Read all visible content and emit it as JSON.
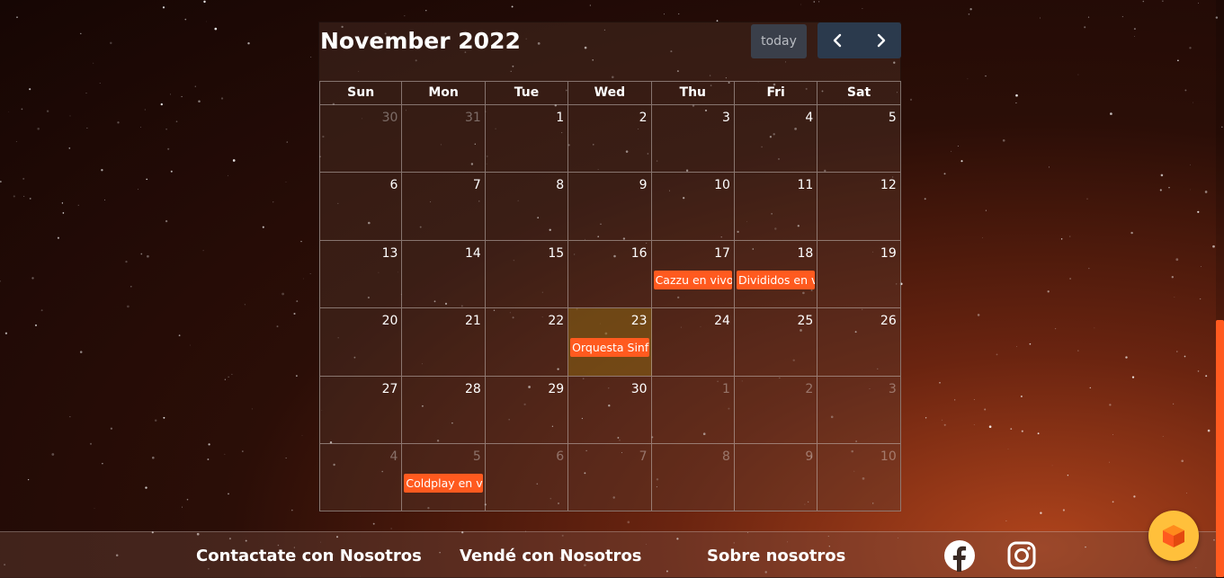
{
  "calendar": {
    "title": "November 2022",
    "today_label": "today",
    "weekdays": [
      "Sun",
      "Mon",
      "Tue",
      "Wed",
      "Thu",
      "Fri",
      "Sat"
    ],
    "weeks": [
      [
        {
          "day": "30",
          "other": true
        },
        {
          "day": "31",
          "other": true
        },
        {
          "day": "1"
        },
        {
          "day": "2"
        },
        {
          "day": "3"
        },
        {
          "day": "4"
        },
        {
          "day": "5"
        }
      ],
      [
        {
          "day": "6"
        },
        {
          "day": "7"
        },
        {
          "day": "8"
        },
        {
          "day": "9"
        },
        {
          "day": "10"
        },
        {
          "day": "11"
        },
        {
          "day": "12"
        }
      ],
      [
        {
          "day": "13"
        },
        {
          "day": "14"
        },
        {
          "day": "15"
        },
        {
          "day": "16"
        },
        {
          "day": "17",
          "event": "Cazzu en vivo"
        },
        {
          "day": "18",
          "event": "Divididos en v"
        },
        {
          "day": "19"
        }
      ],
      [
        {
          "day": "20"
        },
        {
          "day": "21"
        },
        {
          "day": "22"
        },
        {
          "day": "23",
          "today": true,
          "event": "Orquesta Sinfo"
        },
        {
          "day": "24"
        },
        {
          "day": "25"
        },
        {
          "day": "26"
        }
      ],
      [
        {
          "day": "27"
        },
        {
          "day": "28"
        },
        {
          "day": "29"
        },
        {
          "day": "30"
        },
        {
          "day": "1",
          "other": true
        },
        {
          "day": "2",
          "other": true
        },
        {
          "day": "3",
          "other": true
        }
      ],
      [
        {
          "day": "4",
          "other": true
        },
        {
          "day": "5",
          "other": true,
          "event": "Coldplay en vi"
        },
        {
          "day": "6",
          "other": true
        },
        {
          "day": "7",
          "other": true
        },
        {
          "day": "8",
          "other": true
        },
        {
          "day": "9",
          "other": true
        },
        {
          "day": "10",
          "other": true
        }
      ]
    ]
  },
  "footer": {
    "contact": "Contactate con Nosotros",
    "sell": "Vendé con Nosotros",
    "about": "Sobre nosotros",
    "social": [
      "facebook-icon",
      "instagram-icon"
    ]
  },
  "colors": {
    "event": "#ff5a1f",
    "today_bg": "#8c6414",
    "nav_bg": "#2b3a4d",
    "fab": "#ffc03b"
  }
}
